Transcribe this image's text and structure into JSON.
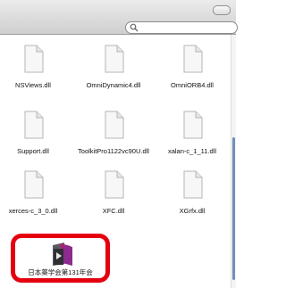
{
  "search": {
    "value": "",
    "placeholder": ""
  },
  "files": [
    {
      "name": "NSViews.dll",
      "icon": "document-icon"
    },
    {
      "name": "OmniDynamic4.dll",
      "icon": "document-icon"
    },
    {
      "name": "OmniORB4.dll",
      "icon": "document-icon"
    },
    {
      "name": "Support.dll",
      "icon": "document-icon"
    },
    {
      "name": "ToolkitPro1122vc90U.dll",
      "icon": "document-icon"
    },
    {
      "name": "xalan-c_1_11.dll",
      "icon": "document-icon"
    },
    {
      "name": "xerces-c_3_0.dll",
      "icon": "document-icon"
    },
    {
      "name": "XFC.dll",
      "icon": "document-icon"
    },
    {
      "name": "XGrfx.dll",
      "icon": "document-icon"
    }
  ],
  "app": {
    "name": "日本薬学会第131年会",
    "icon": "play-folder-app-icon"
  },
  "colors": {
    "highlight": "#e4000f",
    "toolbar": "#dcdcdc"
  }
}
